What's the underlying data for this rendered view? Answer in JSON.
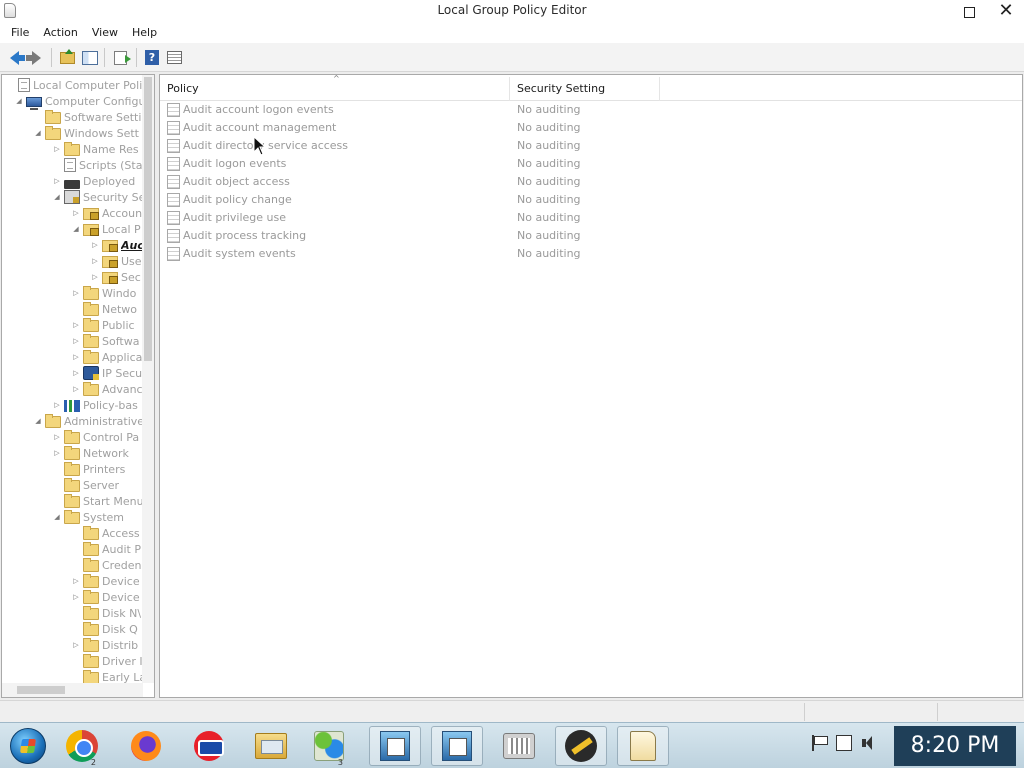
{
  "window": {
    "title": "Local Group Policy Editor"
  },
  "menubar": {
    "items": [
      "File",
      "Action",
      "View",
      "Help"
    ]
  },
  "toolbar": {
    "buttons": [
      "back-icon",
      "forward-icon",
      "up-folder-icon",
      "show-hide-tree-icon",
      "export-list-icon",
      "help-icon",
      "properties-icon"
    ]
  },
  "tree": {
    "items": [
      {
        "label": "Local Computer Polic",
        "icon": "policy-doc-icon",
        "expander": ""
      },
      {
        "label": "Computer Configu",
        "icon": "computer-icon",
        "expander": "expanded"
      },
      {
        "label": "Software Settin",
        "icon": "folder-icon",
        "expander": ""
      },
      {
        "label": "Windows Sett",
        "icon": "folder-icon",
        "expander": "expanded"
      },
      {
        "label": "Name Res",
        "icon": "folder-icon",
        "expander": "collapsed"
      },
      {
        "label": "Scripts (Sta",
        "icon": "scripts-icon",
        "expander": ""
      },
      {
        "label": "Deployed",
        "icon": "printer-icon",
        "expander": "collapsed"
      },
      {
        "label": "Security Se",
        "icon": "security-icon",
        "expander": "expanded"
      },
      {
        "label": "Accoun",
        "icon": "lock-folder-icon",
        "expander": "collapsed"
      },
      {
        "label": "Local P",
        "icon": "lock-folder-icon",
        "expander": "expanded"
      },
      {
        "label": "Auc",
        "icon": "lock-folder-icon",
        "expander": "collapsed",
        "selected": true
      },
      {
        "label": "Use",
        "icon": "lock-folder-icon",
        "expander": "collapsed"
      },
      {
        "label": "Sec",
        "icon": "lock-folder-icon",
        "expander": "collapsed"
      },
      {
        "label": "Windo",
        "icon": "folder-icon",
        "expander": "collapsed"
      },
      {
        "label": "Netwo",
        "icon": "folder-icon",
        "expander": ""
      },
      {
        "label": "Public",
        "icon": "folder-icon",
        "expander": "collapsed"
      },
      {
        "label": "Softwa",
        "icon": "folder-icon",
        "expander": "collapsed"
      },
      {
        "label": "Applica",
        "icon": "folder-icon",
        "expander": "collapsed"
      },
      {
        "label": "IP Secu",
        "icon": "ipsec-icon",
        "expander": "collapsed"
      },
      {
        "label": "Advanc",
        "icon": "folder-icon",
        "expander": "collapsed"
      },
      {
        "label": "Policy-bas",
        "icon": "bar-chart-icon",
        "expander": "collapsed"
      },
      {
        "label": "Administrative",
        "icon": "folder-icon",
        "expander": "expanded"
      },
      {
        "label": "Control Pa",
        "icon": "folder-icon",
        "expander": "collapsed"
      },
      {
        "label": "Network",
        "icon": "folder-icon",
        "expander": "collapsed"
      },
      {
        "label": "Printers",
        "icon": "folder-icon",
        "expander": ""
      },
      {
        "label": "Server",
        "icon": "folder-icon",
        "expander": ""
      },
      {
        "label": "Start Menu",
        "icon": "folder-icon",
        "expander": ""
      },
      {
        "label": "System",
        "icon": "folder-icon",
        "expander": "expanded"
      },
      {
        "label": "Access",
        "icon": "folder-icon",
        "expander": ""
      },
      {
        "label": "Audit P",
        "icon": "folder-icon",
        "expander": ""
      },
      {
        "label": "Creden",
        "icon": "folder-icon",
        "expander": ""
      },
      {
        "label": "Device",
        "icon": "folder-icon",
        "expander": "collapsed"
      },
      {
        "label": "Device",
        "icon": "folder-icon",
        "expander": "collapsed"
      },
      {
        "label": "Disk N\\",
        "icon": "folder-icon",
        "expander": ""
      },
      {
        "label": "Disk Q",
        "icon": "folder-icon",
        "expander": ""
      },
      {
        "label": "Distrib",
        "icon": "folder-icon",
        "expander": "collapsed"
      },
      {
        "label": "Driver I",
        "icon": "folder-icon",
        "expander": ""
      },
      {
        "label": "Early La",
        "icon": "folder-icon",
        "expander": ""
      }
    ]
  },
  "list": {
    "columns": [
      "Policy",
      "Security Setting"
    ],
    "rows": [
      {
        "policy": "Audit account logon events",
        "setting": "No auditing"
      },
      {
        "policy": "Audit account management",
        "setting": "No auditing"
      },
      {
        "policy": "Audit directory service access",
        "setting": "No auditing"
      },
      {
        "policy": "Audit logon events",
        "setting": "No auditing"
      },
      {
        "policy": "Audit object access",
        "setting": "No auditing"
      },
      {
        "policy": "Audit policy change",
        "setting": "No auditing"
      },
      {
        "policy": "Audit privilege use",
        "setting": "No auditing"
      },
      {
        "policy": "Audit process tracking",
        "setting": "No auditing"
      },
      {
        "policy": "Audit system events",
        "setting": "No auditing"
      }
    ]
  },
  "taskbar": {
    "apps": [
      {
        "name": "start-button",
        "badge": ""
      },
      {
        "name": "chrome",
        "badge": "2"
      },
      {
        "name": "firefox",
        "badge": ""
      },
      {
        "name": "opera",
        "badge": ""
      },
      {
        "name": "file-explorer",
        "badge": ""
      },
      {
        "name": "people-app",
        "badge": "3"
      },
      {
        "name": "remote-desktop-1",
        "badge": ""
      },
      {
        "name": "remote-desktop-2",
        "badge": ""
      },
      {
        "name": "store-app",
        "badge": ""
      },
      {
        "name": "media-app",
        "badge": ""
      },
      {
        "name": "group-policy-editor",
        "badge": ""
      }
    ],
    "tray": [
      "action-center-flag-icon",
      "network-icon",
      "volume-icon"
    ],
    "clock": "8:20 PM"
  },
  "colors": {
    "selected_text": "#1a1a1a",
    "dimmed_text": "#9a9a9a",
    "clock_bg": "#1f3f58",
    "taskbar_bg": "#c9dce6"
  }
}
